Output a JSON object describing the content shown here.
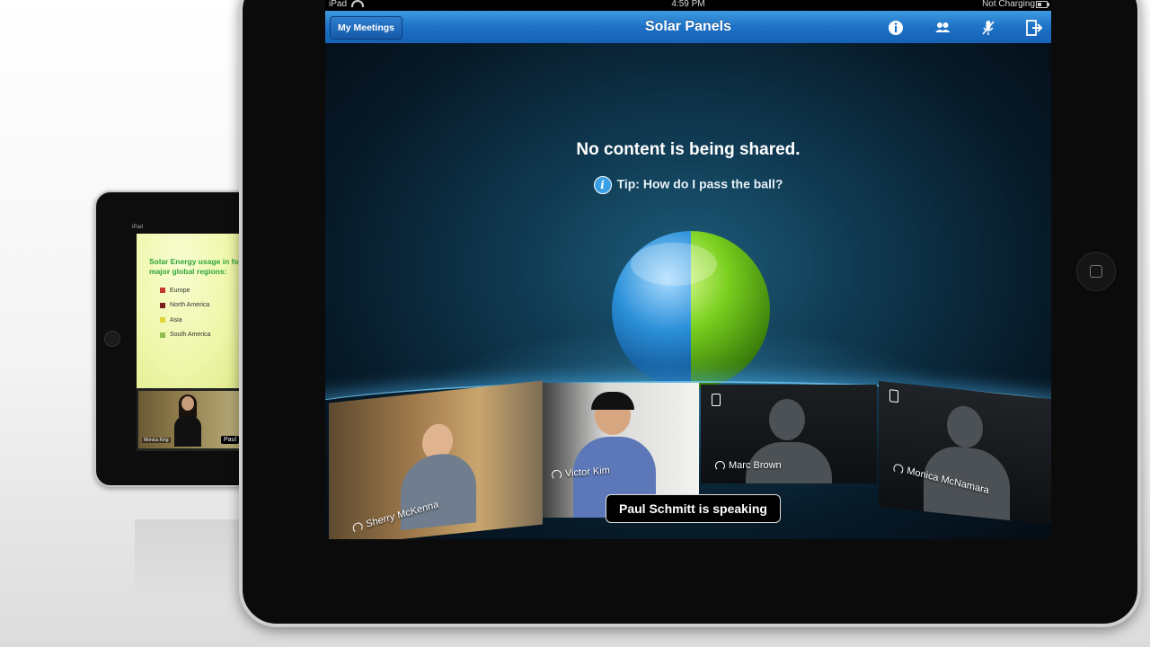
{
  "device_small": {
    "status": "iPad",
    "slide_title": "Solar Energy usage in four major global regions:",
    "legend": [
      {
        "label": "Europe",
        "color": "#c0392b"
      },
      {
        "label": "North America",
        "color": "#7b1e1e"
      },
      {
        "label": "Asia",
        "color": "#e4d23a"
      },
      {
        "label": "South America",
        "color": "#8fbf4a"
      }
    ],
    "thumb_name": "Monica King",
    "thumb_tag": "Paul"
  },
  "statusbar": {
    "device": "iPad",
    "time": "4:59 PM",
    "charge": "Not Charging"
  },
  "navbar": {
    "my_meetings_label": "My Meetings",
    "title": "Solar Panels",
    "icons": [
      "info-icon",
      "participants-icon",
      "mute-mic-icon",
      "leave-meeting-icon"
    ]
  },
  "main": {
    "no_content_text": "No content is being shared.",
    "tip_text": "Tip: How do I pass the ball?"
  },
  "participants": [
    {
      "name": "Sherry McKenna",
      "audio": "headset-icon"
    },
    {
      "name": "Victor Kim",
      "audio": "headset-icon"
    },
    {
      "name": "Marc Brown",
      "audio": "headset-icon",
      "device": "phone-icon"
    },
    {
      "name": "Monica McNamara",
      "audio": "headset-icon",
      "device": "phone-icon"
    }
  ],
  "speaking_banner": "Paul Schmitt is speaking",
  "colors": {
    "navbar_blue": "#1d71c6",
    "ball_blue": "#1e8ad6",
    "ball_green": "#7ad21e",
    "glow": "#5ac8ff"
  }
}
